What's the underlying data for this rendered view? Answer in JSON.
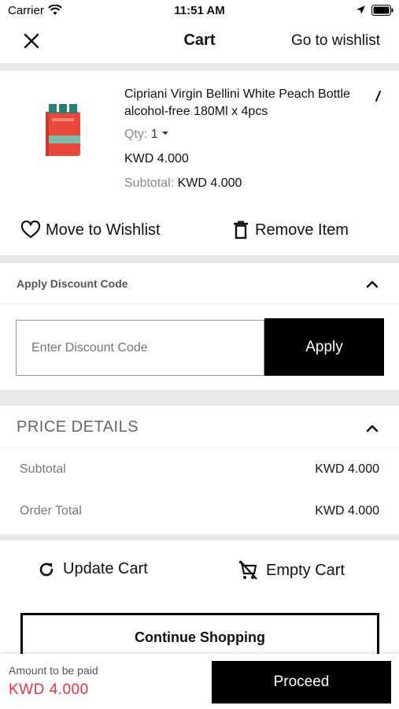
{
  "status_bar": {
    "carrier": "Carrier",
    "time": "11:51 AM"
  },
  "header": {
    "title": "Cart",
    "wishlist_link": "Go to wishlist"
  },
  "item": {
    "name": "Cipriani Virgin Bellini  White Peach Bottle alcohol-free 180Ml x 4pcs",
    "qty_label": "Qty:",
    "qty_value": "1",
    "price": "KWD 4.000",
    "subtotal_label": "Subtotal:",
    "subtotal_value": "KWD 4.000",
    "move_label": "Move to Wishlist",
    "remove_label": "Remove Item"
  },
  "discount": {
    "heading": "Apply Discount Code",
    "placeholder": "Enter Discount Code",
    "apply_label": "Apply"
  },
  "price_details": {
    "heading": "PRICE DETAILS",
    "rows": [
      {
        "label": "Subtotal",
        "value": "KWD 4.000"
      },
      {
        "label": "Order Total",
        "value": "KWD 4.000"
      }
    ]
  },
  "actions": {
    "update_label": "Update Cart",
    "empty_label": "Empty Cart",
    "continue_label": "Continue Shopping"
  },
  "bottom_bar": {
    "amount_label": "Amount to be paid",
    "amount_value": "KWD 4.000",
    "proceed_label": "Proceed"
  },
  "colors": {
    "accent": "#e8333f",
    "primary_button": "#000000",
    "divider": "#e8e8e8"
  },
  "icons": [
    "wifi-icon",
    "location-icon",
    "battery-icon",
    "close-icon",
    "edit-icon",
    "chevron-down-icon",
    "heart-icon",
    "trash-icon",
    "chevron-up-icon",
    "refresh-icon",
    "cart-remove-icon"
  ]
}
